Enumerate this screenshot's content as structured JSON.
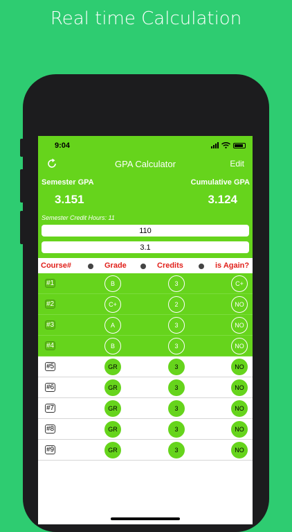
{
  "promo": {
    "title": "Real time Calculation"
  },
  "status": {
    "time": "9:04"
  },
  "nav": {
    "title": "GPA Calculator",
    "edit": "Edit"
  },
  "summary": {
    "semester_label": "Semester GPA",
    "cumulative_label": "Cumulative GPA",
    "semester_gpa": "3.151",
    "cumulative_gpa": "3.124",
    "credit_hours": "Semester Credit Hours: 11",
    "field1_value": "110",
    "field2_value": "3.1"
  },
  "table": {
    "headers": [
      "Course#",
      "Grade",
      "Credits",
      "is Again?"
    ],
    "rows": [
      {
        "course": "#1",
        "grade": "B",
        "credits": "3",
        "again": "C+"
      },
      {
        "course": "#2",
        "grade": "C+",
        "credits": "2",
        "again": "NO"
      },
      {
        "course": "#3",
        "grade": "A",
        "credits": "3",
        "again": "NO"
      },
      {
        "course": "#4",
        "grade": "B",
        "credits": "3",
        "again": "NO"
      },
      {
        "course": "#5",
        "grade": "GR",
        "credits": "3",
        "again": "NO"
      },
      {
        "course": "#6",
        "grade": "GR",
        "credits": "3",
        "again": "NO"
      },
      {
        "course": "#7",
        "grade": "GR",
        "credits": "3",
        "again": "NO"
      },
      {
        "course": "#8",
        "grade": "GR",
        "credits": "3",
        "again": "NO"
      },
      {
        "course": "#9",
        "grade": "GR",
        "credits": "3",
        "again": "NO"
      }
    ]
  },
  "colors": {
    "background": "#2ecc71",
    "accent": "#66d41c",
    "header_text": "#e0201a"
  }
}
